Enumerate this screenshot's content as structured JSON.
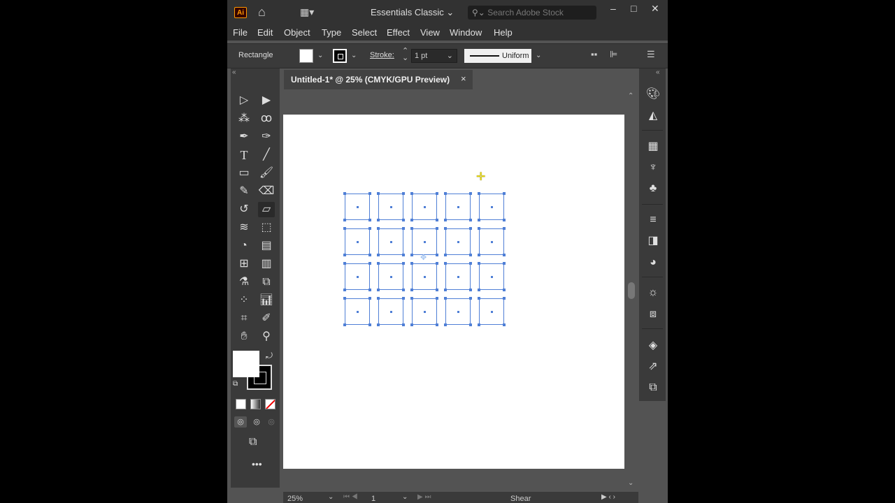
{
  "app": {
    "logo": "Ai"
  },
  "titlebar": {
    "workspace": "Essentials Classic",
    "search_placeholder": "Search Adobe Stock",
    "icons": [
      "home-icon",
      "arrange-documents-icon",
      "search-icon",
      "minimize-icon",
      "maximize-icon",
      "close-icon"
    ]
  },
  "menu": [
    "File",
    "Edit",
    "Object",
    "Type",
    "Select",
    "Effect",
    "View",
    "Window",
    "Help"
  ],
  "control_bar": {
    "selection_label": "Rectangle",
    "stroke_label": "Stroke:",
    "stroke_weight": "1 pt",
    "profile_label": "Uniform",
    "fill_color": "#ffffff",
    "stroke_color": "#000000"
  },
  "document": {
    "tab_title": "Untitled-1* @ 25% (CMYK/GPU Preview)",
    "close_glyph": "×"
  },
  "status": {
    "zoom": "25%",
    "artboard_number": "1",
    "active_tool": "Shear"
  },
  "artwork": {
    "rows": 4,
    "columns": 5,
    "selection_color": "#4f7fd6"
  },
  "colors": {
    "app_bg": "#535353",
    "panel_bg": "#3a3a3a",
    "titlebar_bg": "#323232",
    "accent_ai": "#ff9a00"
  }
}
